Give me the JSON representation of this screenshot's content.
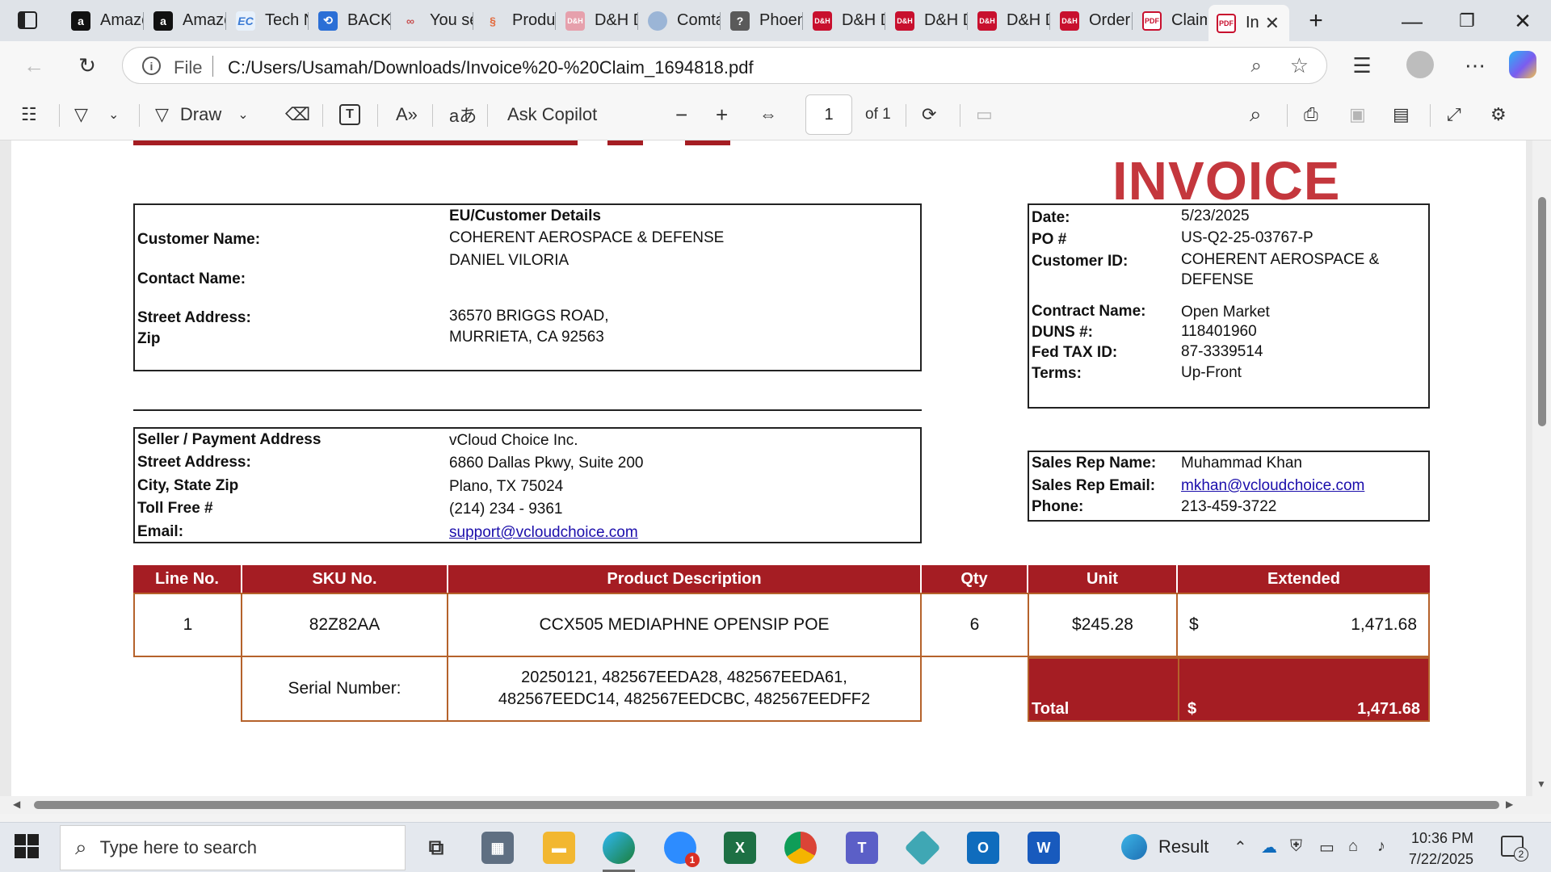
{
  "tabs": [
    {
      "label": "Amazo",
      "favicon": "amazon-icon"
    },
    {
      "label": "Amazo",
      "favicon": "amazon-icon"
    },
    {
      "label": "Tech N",
      "favicon": "techno-icon"
    },
    {
      "label": "BACK-",
      "favicon": "back-icon"
    },
    {
      "label": "You se",
      "favicon": "people-icon"
    },
    {
      "label": "Produ",
      "favicon": "product-icon"
    },
    {
      "label": "D&H D",
      "favicon": "dh-icon"
    },
    {
      "label": "Comta",
      "favicon": "comtag-icon"
    },
    {
      "label": "Phoen",
      "favicon": "phoenix-icon"
    },
    {
      "label": "D&H D",
      "favicon": "dh-icon"
    },
    {
      "label": "D&H D",
      "favicon": "dh-icon"
    },
    {
      "label": "D&H D",
      "favicon": "dh-icon"
    },
    {
      "label": "Order",
      "favicon": "dh-icon"
    },
    {
      "label": "Claim",
      "favicon": "pdf-icon"
    },
    {
      "label": "In",
      "favicon": "pdf-icon"
    }
  ],
  "favicon_text": {
    "amazon": "a",
    "dh": "D&H",
    "pdf": "PDF",
    "tech": "EC"
  },
  "address": {
    "scheme": "File",
    "url": "C:/Users/Usamah/Downloads/Invoice%20-%20Claim_1694818.pdf"
  },
  "toolbar": {
    "draw_label": "Draw",
    "ask_copilot": "Ask Copilot",
    "page_number": "1",
    "page_total": "of 1"
  },
  "invoice": {
    "title": "INVOICE",
    "customer": {
      "heading": "EU/Customer Details",
      "name_label": "Customer Name:",
      "name": "COHERENT AEROSPACE & DEFENSE",
      "contact_label": "Contact Name:",
      "contact": "DANIEL VILORIA",
      "street_label": "Street Address:",
      "zip_label": "Zip",
      "street": "36570 BRIGGS ROAD,",
      "city": "MURRIETA, CA 92563"
    },
    "meta": {
      "date_label": "Date:",
      "date": "5/23/2025",
      "po_label": "PO #",
      "po": "US-Q2-25-03767-P",
      "customer_id_label": "Customer ID:",
      "customer_id_line1": "COHERENT AEROSPACE &",
      "customer_id_line2": "DEFENSE",
      "contract_label": "Contract Name:",
      "contract": "Open Market",
      "duns_label": "DUNS #:",
      "duns": "118401960",
      "tax_label": "Fed TAX ID:",
      "tax": "87-3339514",
      "terms_label": "Terms:",
      "terms": "Up-Front"
    },
    "seller": {
      "heading": "Seller / Payment Address",
      "name": "vCloud Choice Inc.",
      "street_label": "Street Address:",
      "street": "6860 Dallas Pkwy, Suite 200",
      "city_label": "City, State Zip",
      "city": "Plano, TX 75024",
      "tollfree_label": "Toll Free #",
      "tollfree": "(214) 234 - 9361",
      "email_label": "Email:",
      "email": "support@vcloudchoice.com"
    },
    "salesrep": {
      "name_label": "Sales Rep Name:",
      "name": "Muhammad Khan",
      "email_label": "Sales Rep Email:",
      "email": "mkhan@vcloudchoice.com",
      "phone_label": "Phone:",
      "phone": "213-459-3722"
    },
    "table": {
      "headers": [
        "Line No.",
        "SKU No.",
        "Product Description",
        "Qty",
        "Unit",
        "Extended"
      ],
      "row": {
        "line": "1",
        "sku": "82Z82AA",
        "description": "CCX505 MEDIAPHNE OPENSIP POE",
        "qty": "6",
        "unit": "$245.28",
        "currency": "$",
        "extended": "1,471.68"
      },
      "serial_label": "Serial Number:",
      "serial_line1": "20250121,  482567EEDA28,  482567EEDA61,",
      "serial_line2": "482567EEDC14,  482567EEDCBC,  482567EEDFF2",
      "total_label": "Total",
      "total_currency": "$",
      "total": "1,471.68"
    }
  },
  "taskbar": {
    "search_placeholder": "Type here to search",
    "weather_label": "Result",
    "time": "10:36 PM",
    "date": "7/22/2025",
    "notification_count": "2",
    "zoom_badge": "1"
  },
  "colors": {
    "brand_red": "#a51d23",
    "invoice_title": "#c4373d",
    "link": "#1a0dab"
  }
}
